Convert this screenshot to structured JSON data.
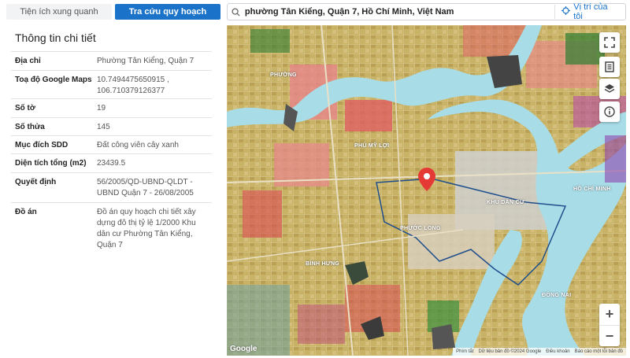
{
  "tabs": {
    "nearby": "Tiện ích xung quanh",
    "lookup": "Tra cứu quy hoạch"
  },
  "search": {
    "value": "phường Tân Kiểng, Quận 7, Hồ Chí Minh, Việt Nam",
    "locate_label": "Vị trí của tôi"
  },
  "panel": {
    "title": "Thông tin chi tiết",
    "rows": [
      {
        "key": "Địa chỉ",
        "value": "Phường Tân Kiểng, Quận 7"
      },
      {
        "key": "Toạ độ Google Maps",
        "value": "10.7494475650915 , 106.710379126377"
      },
      {
        "key": "Số tờ",
        "value": "19"
      },
      {
        "key": "Số thửa",
        "value": "145"
      },
      {
        "key": "Mục đích SDD",
        "value": "Đất công viên cây xanh"
      },
      {
        "key": "Diện tích tổng (m2)",
        "value": "23439.5"
      },
      {
        "key": "Quyết định",
        "value": "56/2005/QD-UBND-QLDT - UBND Quận 7 - 26/08/2005"
      },
      {
        "key": "Đồ án",
        "value": "Đồ án quy hoạch chi tiết xây dựng đô thị tỷ lệ 1/2000 Khu dân cư Phường Tân Kiểng, Quận 7"
      }
    ]
  },
  "map": {
    "labels": {
      "phu_my_loi": "PHÚ MỸ LỢI",
      "phuong_nghi": "PHƯỜNG",
      "ho_chi_minh": "HỒ CHÍ MINH",
      "khu_dan_cu": "KHU DÂN CƯ",
      "hung_long": "BÌNH HƯNG",
      "dong_nai": "ĐÔNG NAI",
      "phuc_hoi": "PHƯỚC LONG"
    },
    "attribution": {
      "shortcuts": "Phím tắt",
      "data": "Dữ liệu bản đồ ©2024 Google",
      "terms": "Điều khoản",
      "report": "Báo cáo một lỗi bản đồ"
    },
    "logo": "Google",
    "zoom_in": "+",
    "zoom_out": "−"
  },
  "colors": {
    "accent": "#1a73c9",
    "map_base": "#c9b46c",
    "river": "#a8dde8",
    "pin": "#e53935"
  }
}
